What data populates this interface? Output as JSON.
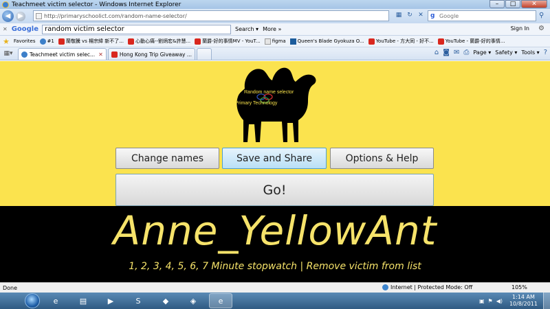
{
  "window": {
    "title": "Teachmeet victim selector - Windows Internet Explorer",
    "minimize": "–",
    "maximize": "□",
    "close": "✕"
  },
  "address_bar": {
    "url": "http://primaryschoolict.com/random-name-selector/",
    "search_placeholder": "Google",
    "back_icon": "◀",
    "forward_icon": "▶"
  },
  "google_toolbar": {
    "logo": "Google",
    "query": "random victim selector",
    "search_label": "Search ▾",
    "more_label": "More »",
    "signin_label": "Sign In"
  },
  "favorites": {
    "label": "Favorites",
    "items": [
      {
        "label": "#1",
        "icon": "ie-icon"
      },
      {
        "label": "蘭敬騰 vs 楊宗緯 新不了...",
        "icon": "youtube-icon"
      },
      {
        "label": "心動心痛--劉炳宏&許慧...",
        "icon": "youtube-icon"
      },
      {
        "label": "蘭爵-好的事情MV - YouT...",
        "icon": "youtube-icon"
      },
      {
        "label": "figma",
        "icon": "page-icon"
      },
      {
        "label": "Queen's Blade Gyokuza O...",
        "icon": "qb-icon"
      },
      {
        "label": "YouTube - 方大同 - 好不...",
        "icon": "youtube-icon"
      },
      {
        "label": "YouTube - 蘭爵-好的事情...",
        "icon": "youtube-icon"
      }
    ]
  },
  "tabs": [
    {
      "label": "Teachmeet victim selec...",
      "active": true
    },
    {
      "label": "Hong Kong Trip Giveaway ...",
      "active": false
    }
  ],
  "command_bar": {
    "page_label": "Page ▾",
    "safety_label": "Safety ▾",
    "tools_label": "Tools ▾"
  },
  "page": {
    "logo_line1": "Random name selector",
    "logo_line2": "Primary Technology",
    "change_names": "Change names",
    "save_share": "Save and Share",
    "options_help": "Options & Help",
    "go": "Go!",
    "selected_name": "Anne_YellowAnt",
    "stopwatch_text": "1, 2, 3, 4, 5, 6, 7 Minute stopwatch | Remove victim from list",
    "colors": {
      "background": "#fbe34e",
      "name_bar": "#000000",
      "name_text": "#f6e36a"
    }
  },
  "status_bar": {
    "left": "Done",
    "zone": "Internet | Protected Mode: Off",
    "zoom": "105%"
  },
  "taskbar": {
    "apps": [
      {
        "name": "internet-explorer-icon",
        "glyph": "e"
      },
      {
        "name": "file-explorer-icon",
        "glyph": "▤"
      },
      {
        "name": "media-player-icon",
        "glyph": "▶"
      },
      {
        "name": "skype-icon",
        "glyph": "S"
      },
      {
        "name": "app-icon",
        "glyph": "◆"
      },
      {
        "name": "windows-update-icon",
        "glyph": "◈"
      },
      {
        "name": "ie-active-icon",
        "glyph": "e"
      }
    ],
    "time": "1:14 AM",
    "date": "10/8/2011"
  }
}
